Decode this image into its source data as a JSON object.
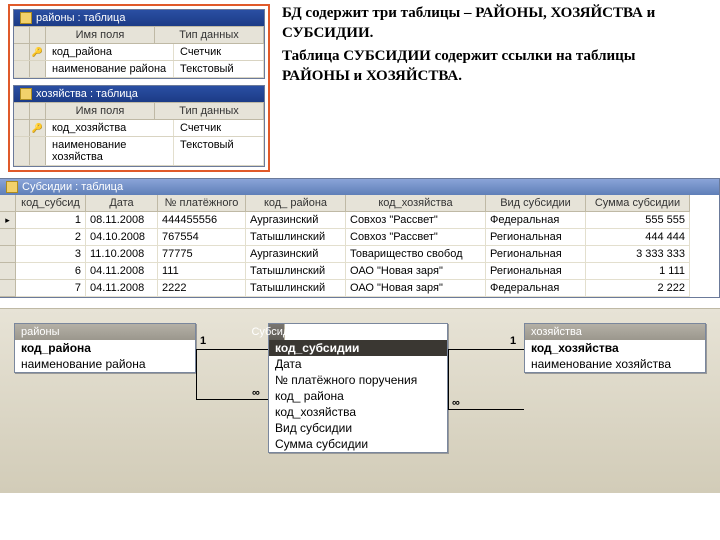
{
  "desc": {
    "p1": "БД содержит три таблицы – РАЙОНЫ, ХОЗЯЙСТВА и СУБСИДИИ.",
    "p2": "Таблица СУБСИДИИ содержит ссылки на таблицы РАЙОНЫ и ХОЗЯЙСТВА."
  },
  "design": {
    "win1": {
      "title": "районы : таблица",
      "h_name": "Имя поля",
      "h_type": "Тип данных",
      "rows": [
        {
          "key": true,
          "name": "код_района",
          "type": "Счетчик"
        },
        {
          "key": false,
          "name": "наименование района",
          "type": "Текстовый"
        }
      ]
    },
    "win2": {
      "title": "хозяйства : таблица",
      "h_name": "Имя поля",
      "h_type": "Тип данных",
      "rows": [
        {
          "key": true,
          "name": "код_хозяйства",
          "type": "Счетчик"
        },
        {
          "key": false,
          "name": "наименование хозяйства",
          "type": "Текстовый"
        }
      ]
    }
  },
  "subs": {
    "title": "Субсидии : таблица",
    "headers": [
      "код_субсид",
      "Дата",
      "№ платёжного",
      "код_ района",
      "код_хозяйства",
      "Вид субсидии",
      "Сумма субсидии"
    ],
    "rows": [
      {
        "id": "1",
        "date": "08.11.2008",
        "num": "444455556",
        "rayon": "Аургазинский",
        "hoz": "Совхоз \"Рассвет\"",
        "vid": "Федеральная",
        "sum": "555 555"
      },
      {
        "id": "2",
        "date": "04.10.2008",
        "num": "767554",
        "rayon": "Татышлинский",
        "hoz": "Совхоз \"Рассвет\"",
        "vid": "Региональная",
        "sum": "444 444"
      },
      {
        "id": "3",
        "date": "11.10.2008",
        "num": "77775",
        "rayon": "Аургазинский",
        "hoz": "Товарищество свобод",
        "vid": "Региональная",
        "sum": "3 333 333"
      },
      {
        "id": "6",
        "date": "04.11.2008",
        "num": "111",
        "rayon": "Татышлинский",
        "hoz": "ОАО \"Новая заря\"",
        "vid": "Региональная",
        "sum": "1 111"
      },
      {
        "id": "7",
        "date": "04.11.2008",
        "num": "2222",
        "rayon": "Татышлинский",
        "hoz": "ОАО \"Новая заря\"",
        "vid": "Федеральная",
        "sum": "2 222"
      }
    ]
  },
  "rel": {
    "b1": {
      "title": "районы",
      "items": [
        "код_района",
        "наименование района"
      ]
    },
    "b2": {
      "title": "Субсидии",
      "items": [
        "код_субсидии",
        "Дата",
        "№ платёжного поручения",
        "код_ района",
        "код_хозяйства",
        "Вид субсидии",
        "Сумма субсидии"
      ]
    },
    "b3": {
      "title": "хозяйства",
      "items": [
        "код_хозяйства",
        "наименование хозяйства"
      ]
    },
    "one": "1",
    "many": "∞"
  }
}
